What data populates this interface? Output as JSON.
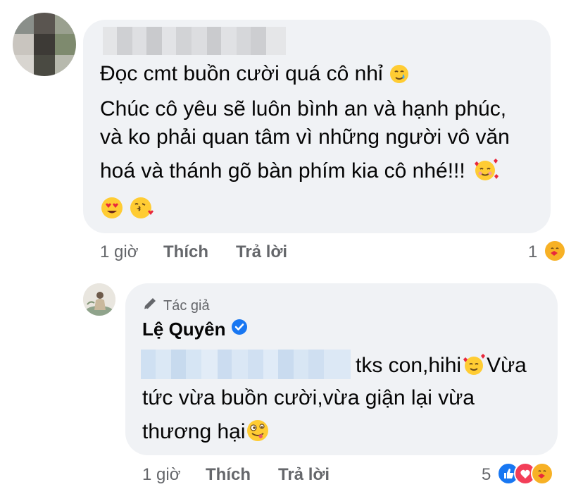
{
  "comment": {
    "lines": [
      "Đọc cmt buồn cười quá cô nhỉ",
      "Chúc cô yêu sẽ luôn bình an và hạnh phúc,",
      "và ko phải quan tâm vì những người vô văn",
      "hoá và thánh gõ bàn phím kia cô nhé!!!"
    ],
    "time": "1 giờ",
    "like_label": "Thích",
    "reply_label": "Trả lời",
    "reaction_count": "1"
  },
  "reply": {
    "badge": "Tác giả",
    "author": "Lệ Quyên",
    "lines": [
      "tks con,hihi",
      "Vừa",
      "tức vừa buồn cười,vừa giận lại vừa",
      "thương hại"
    ],
    "time": "1 giờ",
    "like_label": "Thích",
    "reply_label": "Trả lời",
    "reaction_count": "5"
  },
  "colors": {
    "bubble": "#f0f2f5",
    "meta_text": "#65676b",
    "verified": "#1877f2",
    "like": "#1877f2",
    "love": "#f33e58",
    "care": "#f7b125"
  },
  "icons": [
    "smile-tear-icon",
    "smiling-hearts-icon",
    "heart-eyes-icon",
    "kiss-heart-icon",
    "pencil-icon",
    "verified-icon",
    "zany-face-icon",
    "like-icon",
    "love-icon",
    "care-icon"
  ]
}
